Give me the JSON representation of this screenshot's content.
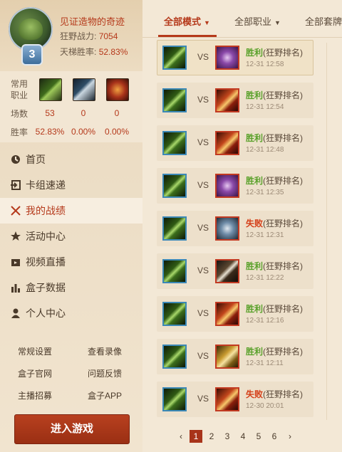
{
  "profile": {
    "level": "3",
    "name": "见证造物的奇迹",
    "power_label": "狂野战力:",
    "power_value": "7054",
    "ladder_label": "天梯胜率:",
    "ladder_value": "52.83%"
  },
  "classes": {
    "row_label_common": "常用",
    "row_label_class": "职业",
    "games_label": "场数",
    "winrate_label": "胜率",
    "icons": [
      "druid-claw-icon",
      "warrior-sword-icon",
      "demon-hunter-icon"
    ],
    "games": [
      "53",
      "0",
      "0"
    ],
    "winrates": [
      "52.83%",
      "0.00%",
      "0.00%"
    ]
  },
  "nav": [
    {
      "label": "首页",
      "icon": "home-icon"
    },
    {
      "label": "卡组速递",
      "icon": "login-arrow-icon"
    },
    {
      "label": "我的战绩",
      "icon": "crossed-swords-icon",
      "active": true
    },
    {
      "label": "活动中心",
      "icon": "star-icon"
    },
    {
      "label": "视频直播",
      "icon": "video-icon"
    },
    {
      "label": "盒子数据",
      "icon": "bar-chart-icon"
    },
    {
      "label": "个人中心",
      "icon": "person-icon"
    }
  ],
  "links": [
    "常规设置",
    "查看录像",
    "盒子官网",
    "问题反馈",
    "主播招募",
    "盒子APP"
  ],
  "enter_button": "进入游戏",
  "tabs": [
    {
      "label": "全部模式",
      "active": true
    },
    {
      "label": "全部职业"
    },
    {
      "label": "全部套牌"
    }
  ],
  "vs_label": "VS",
  "matches": [
    {
      "result": "胜利",
      "win": true,
      "mode": "(狂野排名)",
      "time": "12-31 12:58",
      "opp": "purple-dragon-icon",
      "highlight": true
    },
    {
      "result": "胜利",
      "win": true,
      "mode": "(狂野排名)",
      "time": "12-31 12:54",
      "opp": "fire-blade-icon"
    },
    {
      "result": "胜利",
      "win": true,
      "mode": "(狂野排名)",
      "time": "12-31 12:48",
      "opp": "fire-blade-icon"
    },
    {
      "result": "胜利",
      "win": true,
      "mode": "(狂野排名)",
      "time": "12-31 12:35",
      "opp": "purple-dragon-icon"
    },
    {
      "result": "失败",
      "win": false,
      "mode": "(狂野排名)",
      "time": "12-31 12:31",
      "opp": "mech-icon"
    },
    {
      "result": "胜利",
      "win": true,
      "mode": "(狂野排名)",
      "time": "12-31 12:22",
      "opp": "sword-icon"
    },
    {
      "result": "胜利",
      "win": true,
      "mode": "(狂野排名)",
      "time": "12-31 12:16",
      "opp": "fire-blade-icon"
    },
    {
      "result": "胜利",
      "win": true,
      "mode": "(狂野排名)",
      "time": "12-31 12:11",
      "opp": "golden-tome-icon"
    },
    {
      "result": "失败",
      "win": false,
      "mode": "(狂野排名)",
      "time": "12-30 20:01",
      "opp": "fire-blade-icon"
    }
  ],
  "pager": {
    "prev": "‹",
    "next": "›",
    "pages": [
      "1",
      "2",
      "3",
      "4",
      "5",
      "6"
    ],
    "current": "1"
  },
  "colors": {
    "accent": "#b5391b",
    "win": "#5aa12b",
    "lose": "#d43d16"
  }
}
